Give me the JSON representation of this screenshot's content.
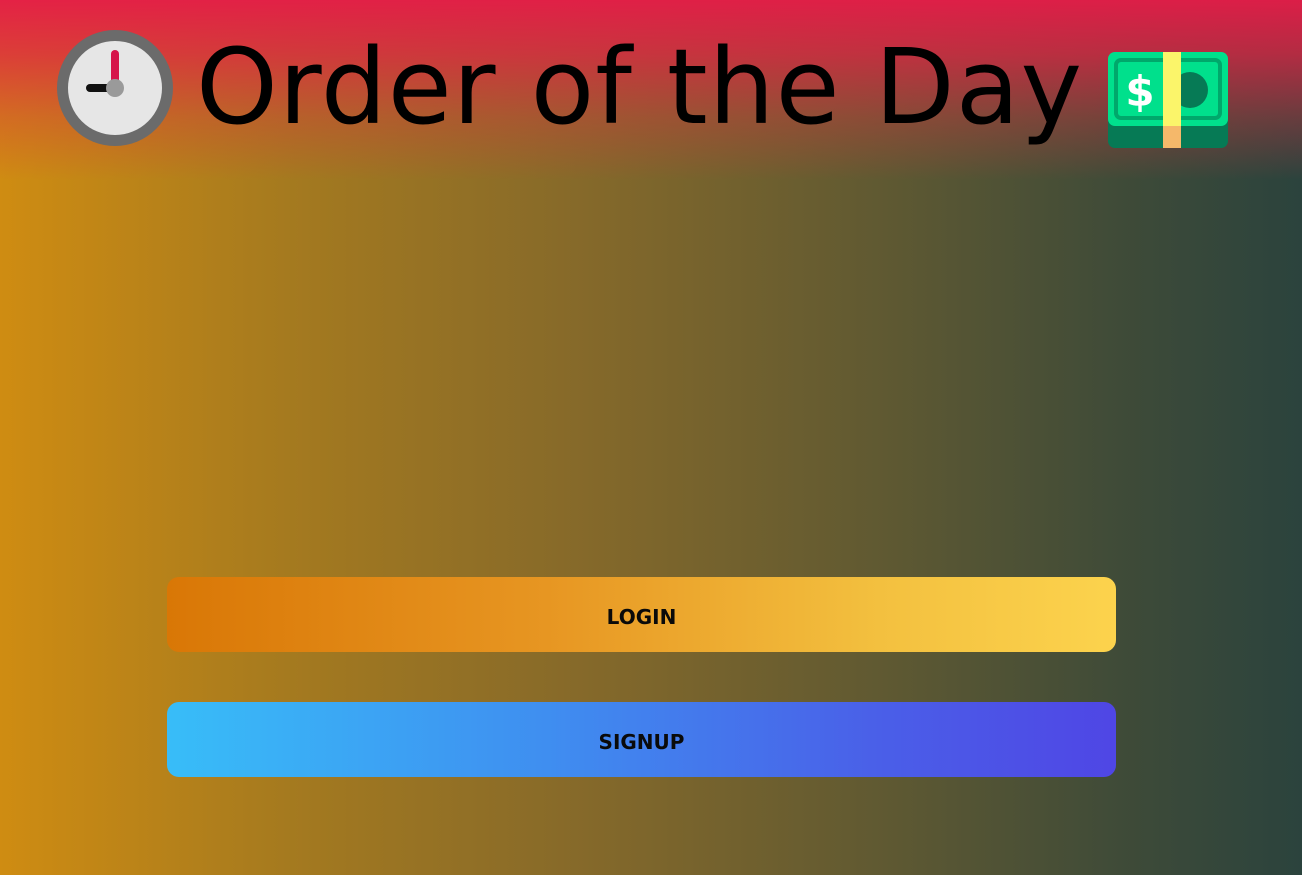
{
  "header": {
    "title": "Order of the Day",
    "left_icon": "clock-nine-icon",
    "right_icon": "dollar-banknote-icon"
  },
  "actions": {
    "login_label": "LOGIN",
    "signup_label": "SIGNUP"
  },
  "colors": {
    "background_left": "#cf8c12",
    "background_right": "#2b433d",
    "header_tint": "#e51c48",
    "login_gradient": [
      "#d97706",
      "#fcd34d"
    ],
    "signup_gradient": [
      "#38bdf8",
      "#4f46e5"
    ],
    "text": "#000000"
  }
}
